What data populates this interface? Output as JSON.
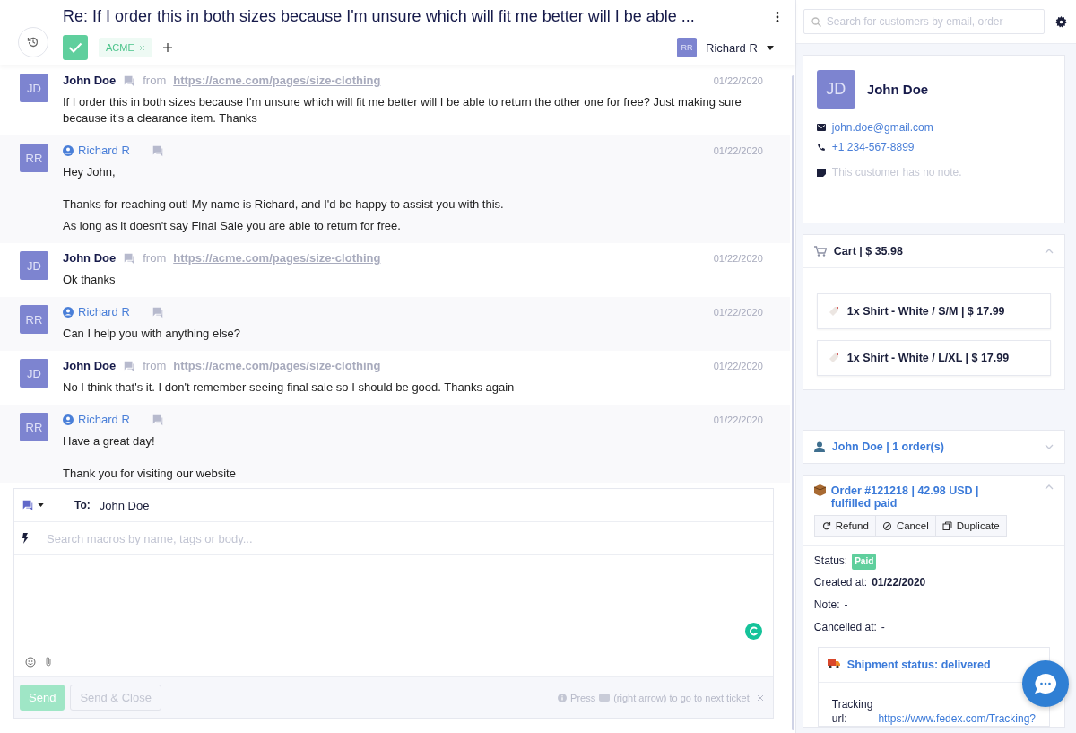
{
  "ticket": {
    "title": "Re: If I order this in both sizes because I'm unsure which will fit me better will I be able ...",
    "tags": [
      {
        "label": "ACME"
      }
    ],
    "assignee": {
      "initials": "RR",
      "name": "Richard R"
    }
  },
  "messages": [
    {
      "kind": "customer",
      "initials": "JD",
      "author": "John Doe",
      "source_prefix": "from",
      "source_url": "https://acme.com/pages/size-clothing",
      "date": "01/22/2020",
      "paragraphs": [
        "If I order this in both sizes because I'm unsure which will fit me better will I be able to return the other one for free? Just making sure because it's a clearance item. Thanks"
      ]
    },
    {
      "kind": "agent",
      "initials": "RR",
      "author": "Richard R",
      "date": "01/22/2020",
      "paragraphs": [
        "Hey John,",
        "Thanks for reaching out! My name is Richard, and I'd be happy to assist you with this.",
        "As long as it doesn't say Final Sale you are able to return for free."
      ]
    },
    {
      "kind": "customer",
      "initials": "JD",
      "author": "John Doe",
      "source_prefix": "from",
      "source_url": "https://acme.com/pages/size-clothing",
      "date": "01/22/2020",
      "paragraphs": [
        "Ok thanks"
      ]
    },
    {
      "kind": "agent",
      "initials": "RR",
      "author": "Richard R",
      "date": "01/22/2020",
      "paragraphs": [
        "Can I help you with anything else?"
      ]
    },
    {
      "kind": "customer",
      "initials": "JD",
      "author": "John Doe",
      "source_prefix": "from",
      "source_url": "https://acme.com/pages/size-clothing",
      "date": "01/22/2020",
      "paragraphs": [
        "No I think that's it. I don't remember seeing final sale so I should be good. Thanks again"
      ]
    },
    {
      "kind": "agent",
      "initials": "RR",
      "author": "Richard R",
      "date": "01/22/2020",
      "paragraphs": [
        "Have a great day!",
        "Thank you for visiting our website"
      ]
    }
  ],
  "composer": {
    "to_label": "To:",
    "to": "John Doe",
    "macro_placeholder": "Search macros by name, tags or body...",
    "send": {
      "label": "Send",
      "disabled": true
    },
    "send_close": {
      "label": "Send & Close",
      "disabled": true
    },
    "hint_before": "Press",
    "hint_after": "(right arrow) to go to next ticket"
  },
  "sidebar": {
    "search_placeholder": "Search for customers by email, order",
    "customer": {
      "initials": "JD",
      "name": "John Doe",
      "email": "john.doe@gmail.com",
      "phone": "+1 234-567-8899",
      "note": "This customer has no note."
    },
    "cart": {
      "title": "Cart | $ 35.98",
      "expanded": true,
      "items": [
        "1x Shirt - White / S/M | $ 17.99",
        "1x Shirt - White / L/XL | $ 17.99"
      ]
    },
    "orders_summary": {
      "title": "John Doe | 1 order(s)",
      "expanded": false
    },
    "order": {
      "title": "Order #121218 | 42.98 USD | fulfilled paid",
      "expanded": true,
      "actions": [
        "Refund",
        "Cancel",
        "Duplicate"
      ],
      "status": {
        "label": "Status:",
        "value": "Paid"
      },
      "created_at": {
        "label": "Created at:",
        "value": "01/22/2020"
      },
      "note": {
        "label": "Note:",
        "value": "-"
      },
      "cancelled_at": {
        "label": "Cancelled at:",
        "value": "-"
      },
      "shipment": {
        "title": "Shipment status: delivered",
        "tracking_label": "Tracking url:",
        "tracking_url": "https://www.fedex.com/Tracking?"
      }
    }
  }
}
